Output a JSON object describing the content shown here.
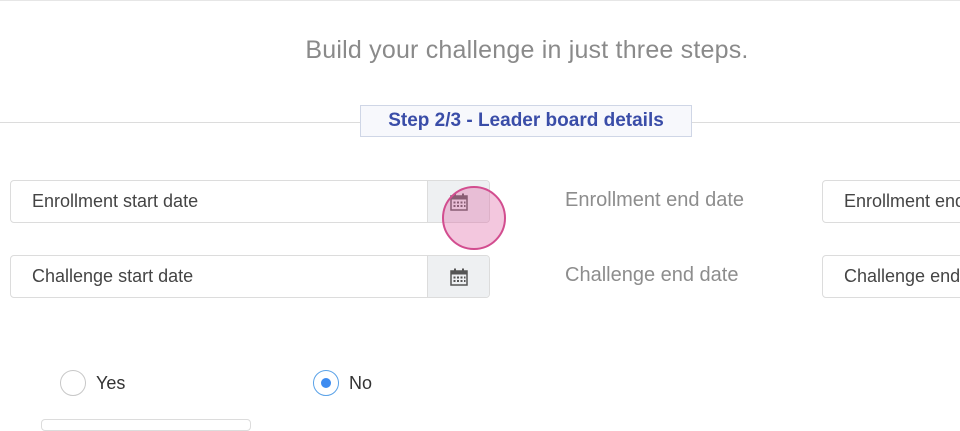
{
  "headline": "Build your challenge in just three steps.",
  "step_title": "Step 2/3 - Leader board details",
  "fields": {
    "enrollment_start": "Enrollment start date",
    "enrollment_end_label": "Enrollment end date",
    "enrollment_end_value": "Enrollment end date",
    "challenge_start": "Challenge start date",
    "challenge_end_label": "Challenge end date",
    "challenge_end_value": "Challenge end date"
  },
  "options": {
    "yes": "Yes",
    "no": "No",
    "selected": "No"
  },
  "icons": {
    "calendar": "calendar-icon"
  },
  "colors": {
    "step_title": "#3a4da8",
    "radio_selected": "#3d8bf0",
    "click_indicator": "#d24d8f"
  }
}
